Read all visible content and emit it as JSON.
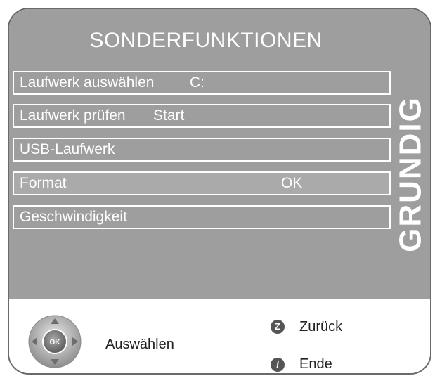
{
  "menu": {
    "title": "SONDERFUNKTIONEN",
    "items": [
      {
        "label": "Laufwerk auswählen",
        "value": "C:"
      },
      {
        "label": "Laufwerk prüfen",
        "value": "Start"
      },
      {
        "label": "USB-Laufwerk",
        "value": ""
      },
      {
        "label": "Format",
        "value": "OK"
      },
      {
        "label": "Geschwindigkeit",
        "value": ""
      }
    ]
  },
  "brand": {
    "logo_text": "GRUNDIG"
  },
  "footer": {
    "select_label": "Auswählen",
    "ok_text": "OK",
    "back_key": "Z",
    "back_label": "Zurück",
    "exit_key": "i",
    "exit_label": "Ende"
  },
  "colors": {
    "panel": "#9e9e9e",
    "text": "#ffffff",
    "footer_bg": "#ffffff",
    "border": "#6a6a6a"
  }
}
